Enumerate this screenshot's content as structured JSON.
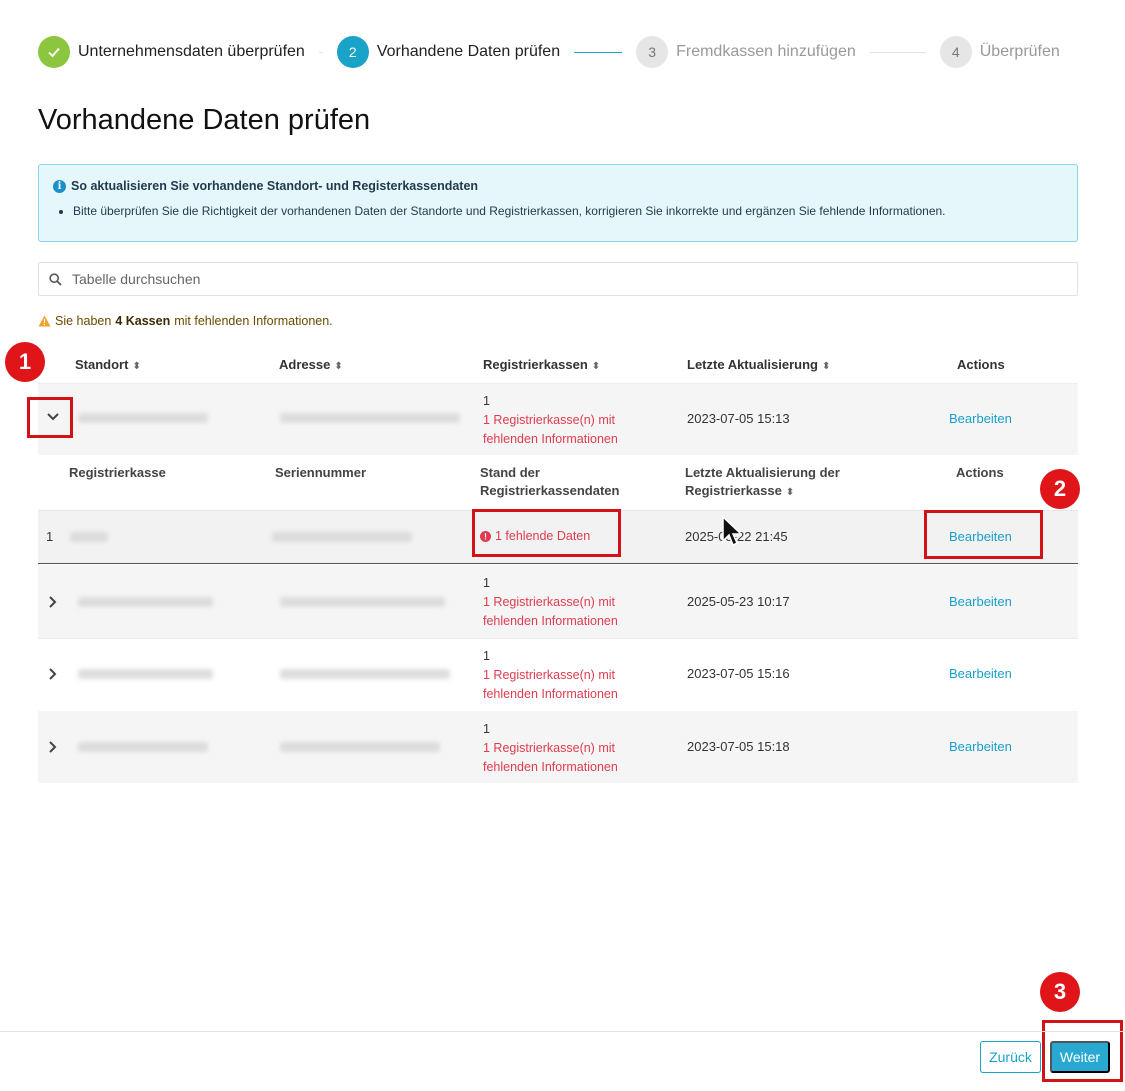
{
  "stepper": {
    "steps": [
      {
        "number": "✓",
        "label": "Unternehmensdaten überprüfen",
        "state": "done"
      },
      {
        "number": "2",
        "label": "Vorhandene Daten prüfen",
        "state": "active"
      },
      {
        "number": "3",
        "label": "Fremdkassen hinzufügen",
        "state": "todo"
      },
      {
        "number": "4",
        "label": "Überprüfen",
        "state": "todo"
      }
    ]
  },
  "page_title": "Vorhandene Daten prüfen",
  "info": {
    "title": "So aktualisieren Sie vorhandene Standort- und Registerkassendaten",
    "items": [
      "Bitte überprüfen Sie die Richtigkeit der vorhandenen Daten der Standorte und Registrierkassen, korrigieren Sie inkorrekte und ergänzen Sie fehlende Informationen."
    ]
  },
  "search": {
    "placeholder": "Tabelle durchsuchen"
  },
  "warning": {
    "lead": "Sie haben",
    "count": "4 Kassen",
    "rest": "mit fehlenden Informationen."
  },
  "table": {
    "headers": {
      "standort": "Standort",
      "adresse": "Adresse",
      "registrierkassen": "Registrierkassen",
      "letzte": "Letzte Aktualisierung",
      "actions": "Actions"
    },
    "rows": [
      {
        "count": "1",
        "missing": "1 Registrierkasse(n) mit fehlenden Informationen",
        "updated": "2023-07-05 15:13",
        "action": "Bearbeiten",
        "expanded": true
      },
      {
        "count": "1",
        "missing": "1 Registrierkasse(n) mit fehlenden Informationen",
        "updated": "2025-05-23 10:17",
        "action": "Bearbeiten"
      },
      {
        "count": "1",
        "missing": "1 Registrierkasse(n) mit fehlenden Informationen",
        "updated": "2023-07-05 15:16",
        "action": "Bearbeiten"
      },
      {
        "count": "1",
        "missing": "1 Registrierkasse(n) mit fehlenden Informationen",
        "updated": "2023-07-05 15:18",
        "action": "Bearbeiten"
      }
    ],
    "subtable": {
      "headers": {
        "kasse": "Registrierkasse",
        "serial": "Seriennummer",
        "stand": "Stand der Registrierkassendaten",
        "letzte": "Letzte Aktualisierung der Registrierkasse",
        "actions": "Actions"
      },
      "rows": [
        {
          "index": "1",
          "status": "1 fehlende Daten",
          "updated": "2025-05-22 21:45",
          "action": "Bearbeiten"
        }
      ]
    }
  },
  "annotations": [
    "1",
    "2",
    "3"
  ],
  "footer": {
    "back": "Zurück",
    "next": "Weiter"
  }
}
